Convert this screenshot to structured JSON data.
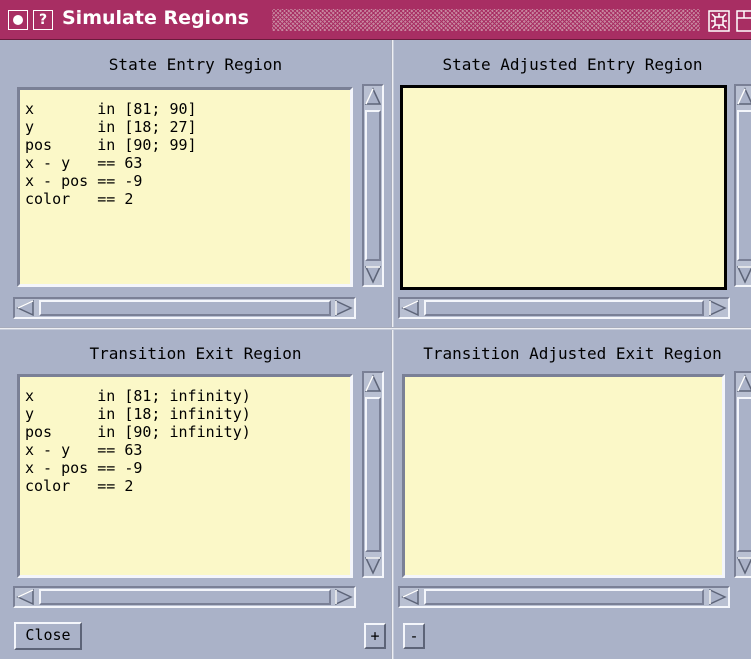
{
  "window": {
    "title": "Simulate Regions",
    "menu_icon": "window-menu-icon",
    "help_label": "?",
    "maximize_icon": "maximize-icon"
  },
  "panes": {
    "state_entry": {
      "title": "State Entry Region",
      "text": "x       in [81; 90]\ny       in [18; 27]\npos     in [90; 99]\nx - y   == 63\nx - pos == -9\ncolor   == 2"
    },
    "state_adjusted_entry": {
      "title": "State Adjusted Entry Region",
      "text": ""
    },
    "transition_exit": {
      "title": "Transition Exit Region",
      "text": "x       in [81; infinity)\ny       in [18; infinity)\npos     in [90; infinity)\nx - y   == 63\nx - pos == -9\ncolor   == 2"
    },
    "transition_adjusted_exit": {
      "title": "Transition Adjusted Exit Region",
      "text": ""
    }
  },
  "buttons": {
    "close": "Close",
    "plus": "+",
    "minus": "-"
  },
  "colors": {
    "title_bar": "#a82e63",
    "background": "#aab2c8",
    "text_area": "#fbf8c8"
  }
}
